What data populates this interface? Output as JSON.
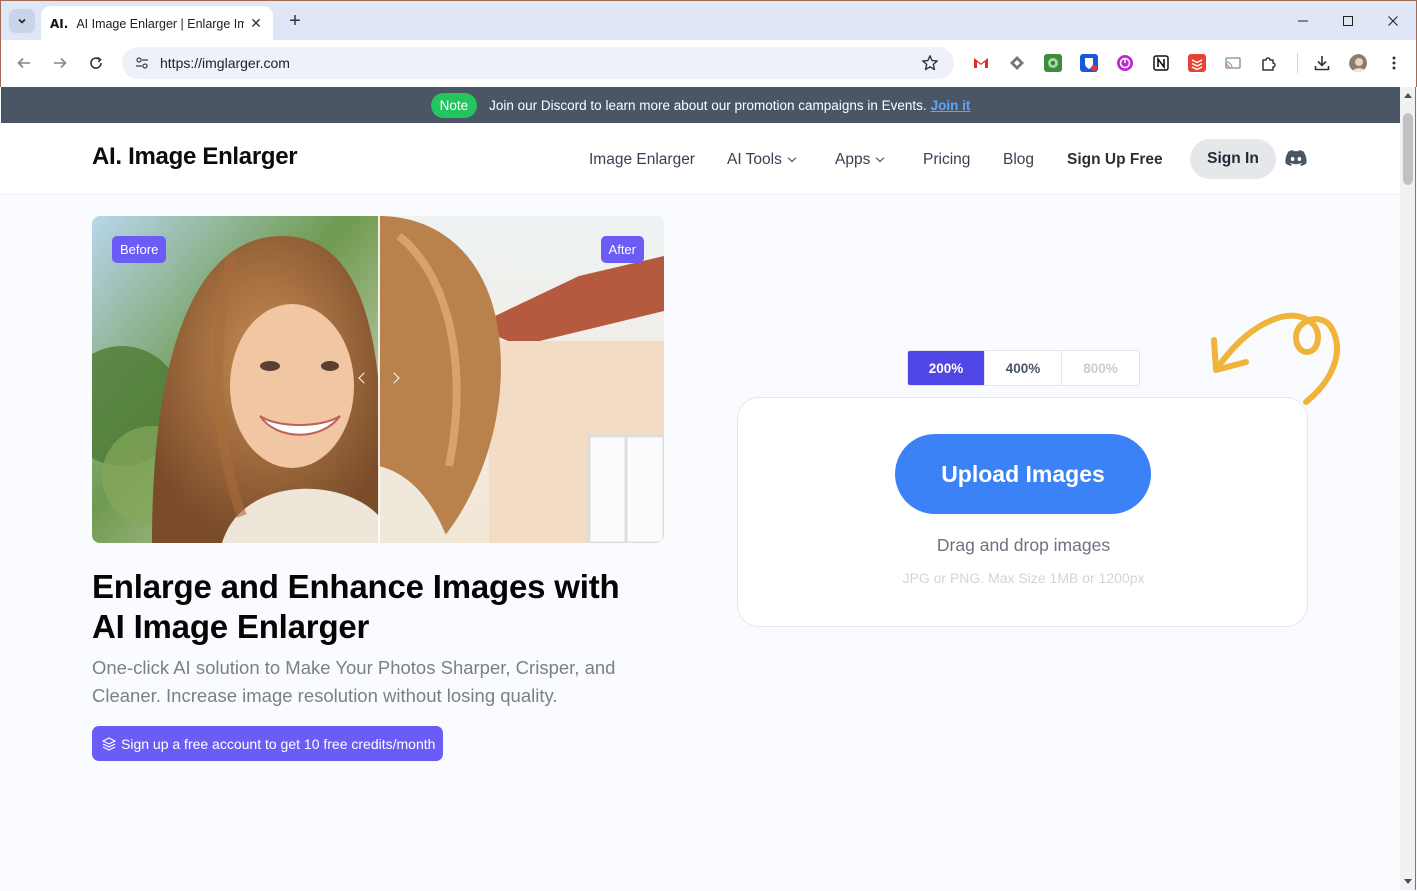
{
  "browser": {
    "tab": {
      "favicon_text": "AI.",
      "title": "AI Image Enlarger | Enlarge Im",
      "close": "✕"
    },
    "new_tab": "+",
    "url": "https://imglarger.com",
    "window": {
      "minimize": "—",
      "maximize": "☐",
      "close": "✕"
    },
    "extensions": [
      "gmail-icon",
      "feedly-icon",
      "maps-extension-icon",
      "bitwarden-icon",
      "focus-timer-icon",
      "notion-icon",
      "todoist-icon",
      "cast-icon",
      "extensions-puzzle-icon",
      "download-icon",
      "profile-avatar"
    ]
  },
  "notice": {
    "badge": "Note",
    "text": "Join our Discord to learn more about our promotion campaigns in Events.",
    "link": "Join it"
  },
  "header": {
    "logo": "AI. Image Enlarger",
    "nav": {
      "image_enlarger": "Image Enlarger",
      "ai_tools": "AI Tools",
      "apps": "Apps",
      "pricing": "Pricing",
      "blog": "Blog",
      "sign_up_free": "Sign Up Free",
      "sign_in": "Sign In"
    }
  },
  "compare": {
    "before": "Before",
    "after": "After"
  },
  "hero": {
    "title": "Enlarge and Enhance Images with AI Image Enlarger",
    "subtitle": "One-click AI solution to Make Your Photos Sharper, Crisper, and Cleaner. Increase image resolution without losing quality.",
    "cta": "Sign up a free account to get 10 free credits/month"
  },
  "scale": {
    "options": [
      "200%",
      "400%",
      "800%"
    ],
    "selected": "200%"
  },
  "upload": {
    "button": "Upload Images",
    "drag": "Drag and drop images",
    "limits": "JPG or PNG. Max Size 1MB or 1200px"
  },
  "colors": {
    "accent_purple": "#6b5cf6",
    "upload_blue": "#3b82f6",
    "scale_active": "#4f46e5",
    "note_green": "#22c55e",
    "notice_bg": "#4a5565",
    "arrow_yellow": "#f0b43a"
  }
}
